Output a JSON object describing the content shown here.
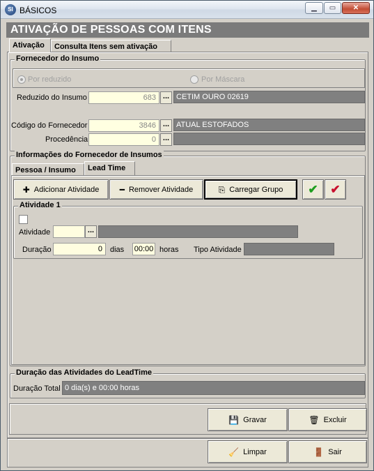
{
  "window": {
    "title": "BÁSICOS",
    "app_icon": "database-gear-icon"
  },
  "header": {
    "title": "ATIVAÇÃO DE PESSOAS COM ITENS"
  },
  "tabs": [
    "Ativação",
    "Consulta Itens sem ativação"
  ],
  "fornecedor_insumo": {
    "group_title": "Fornecedor do Insumo",
    "radio_reduzido": "Por reduzido",
    "radio_mascara": "Por Máscara",
    "reduzido_label": "Reduzido do Insumo",
    "reduzido_value": "683",
    "reduzido_desc": "CETIM OURO   02619",
    "codigo_label": "Código do Fornecedor",
    "codigo_value": "3846",
    "codigo_desc": "ATUAL ESTOFADOS",
    "procedencia_label": "Procedência",
    "procedencia_value": "0",
    "procedencia_desc": "",
    "lookup_label": "..."
  },
  "info_fornecedor": {
    "group_title": "Informações do Fornecedor de Insumos",
    "tabs": [
      "Pessoa / Insumo",
      "Lead Time"
    ]
  },
  "lead_time": {
    "add_button": "Adicionar Atividade",
    "remove_button": "Remover Atividade",
    "load_button": "Carregar Grupo",
    "atividade_group": "Atividade 1",
    "atividade_label": "Atividade",
    "atividade_value": "",
    "atividade_desc": "",
    "duracao_label": "Duração",
    "duracao_days": "0",
    "dias_label": "dias",
    "duracao_time": "00:00",
    "horas_label": "horas",
    "tipo_label": "Tipo Atividade",
    "tipo_value": ""
  },
  "duracao": {
    "group_title": "Duração das Atividades do LeadTime",
    "total_label": "Duração Total",
    "total_value": "0 dia(s) e 00:00 horas"
  },
  "actions": {
    "gravar": "Gravar",
    "excluir": "Excluir",
    "limpar": "Limpar",
    "sair": "Sair"
  },
  "colors": {
    "header_bg": "#7b7b7b",
    "readonly_bg": "#808080",
    "input_bg": "#ffffe1",
    "window_bg": "#d4d0c8",
    "confirm_green": "#1e9e1e",
    "confirm_red": "#c8102e"
  }
}
